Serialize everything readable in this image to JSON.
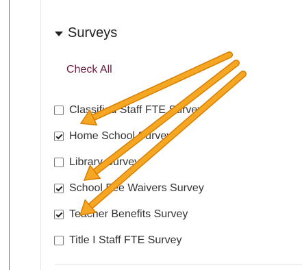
{
  "section": {
    "title": "Surveys",
    "check_all_label": "Check All"
  },
  "surveys": [
    {
      "label": "Classified Staff FTE Survey",
      "checked": false
    },
    {
      "label": "Home School Survey",
      "checked": true
    },
    {
      "label": "Library Survey",
      "checked": false
    },
    {
      "label": "School Fee Waivers Survey",
      "checked": true
    },
    {
      "label": "Teacher Benefits Survey",
      "checked": true
    },
    {
      "label": "Title I Staff FTE Survey",
      "checked": false
    }
  ],
  "annotations": {
    "arrow_color": "#f5a623",
    "arrow_outline": "#d87e00"
  }
}
